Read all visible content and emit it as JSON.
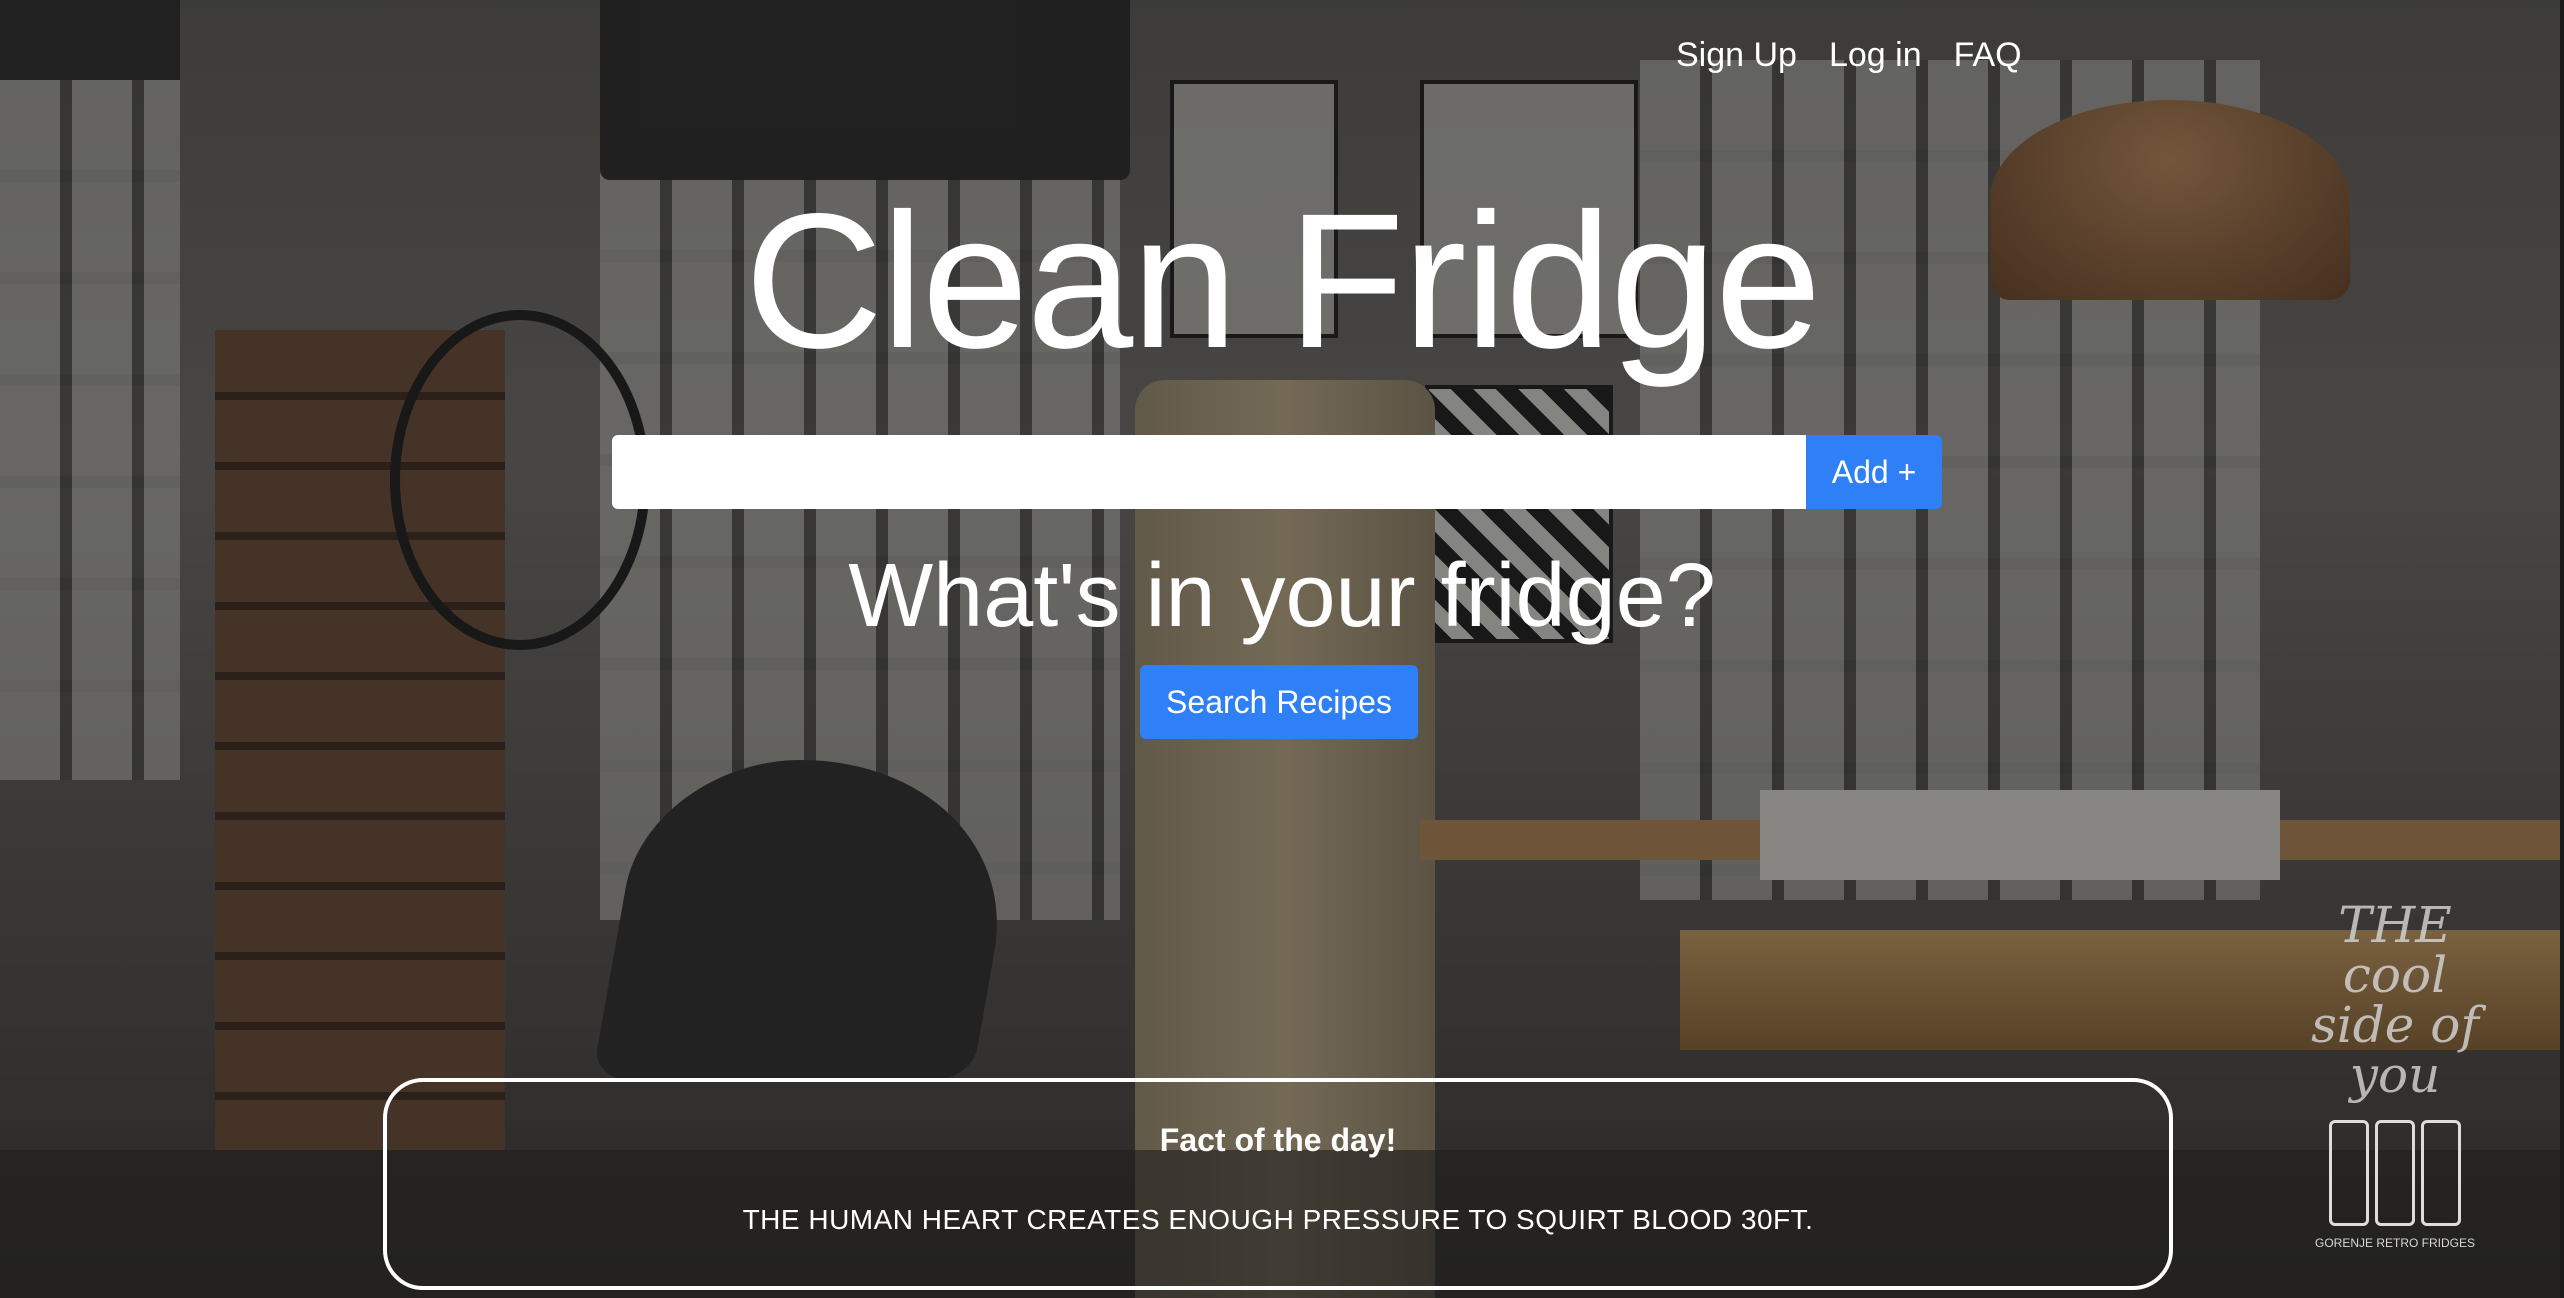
{
  "nav": {
    "items": [
      {
        "label": "Sign Up"
      },
      {
        "label": "Log in"
      },
      {
        "label": "FAQ"
      }
    ]
  },
  "hero": {
    "title": "Clean Fridge",
    "input_value": "",
    "add_label": "Add +",
    "question": "What's in your fridge?",
    "search_label": "Search Recipes"
  },
  "fact": {
    "title": "Fact of the day!",
    "text": "THE HUMAN HEART CREATES ENOUGH PRESSURE TO SQUIRT BLOOD 30FT."
  },
  "ad": {
    "slogan": "THE cool side of you",
    "caption": "GORENJE RETRO FRIDGES"
  },
  "colors": {
    "accent": "#2f7ff7",
    "text": "#ffffff"
  }
}
